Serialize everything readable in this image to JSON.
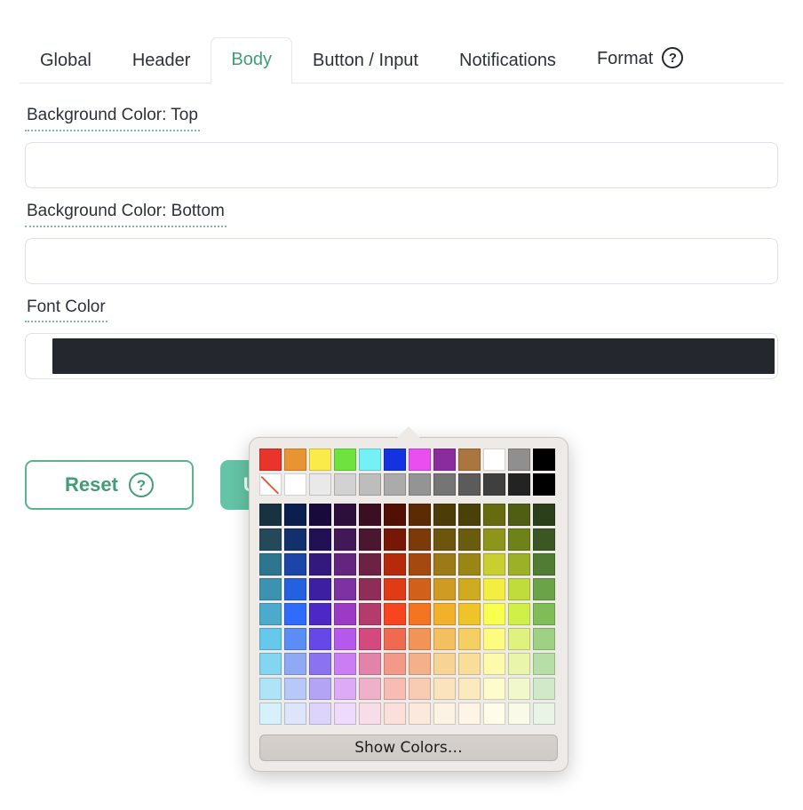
{
  "tabs": [
    {
      "label": "Global",
      "active": false,
      "help": false
    },
    {
      "label": "Header",
      "active": false,
      "help": false
    },
    {
      "label": "Body",
      "active": true,
      "help": false
    },
    {
      "label": "Button / Input",
      "active": false,
      "help": false
    },
    {
      "label": "Notifications",
      "active": false,
      "help": false
    },
    {
      "label": "Format",
      "active": false,
      "help": true
    }
  ],
  "help_icon": "?",
  "fields": [
    {
      "label": "Background Color: Top",
      "value": "",
      "filled": false
    },
    {
      "label": "Background Color: Bottom",
      "value": "",
      "filled": false
    },
    {
      "label": "Font Color",
      "value": "#24282e",
      "filled": true
    }
  ],
  "actions": {
    "reset_label": "Reset",
    "reset_help": "?",
    "update_label": "Update"
  },
  "theme": {
    "accent_green": "#3f9d77",
    "update_button_bg": "#64c4a5",
    "label_underline": "#7fba9e",
    "text_color": "#2d3239",
    "input_border": "#dde2ea",
    "popover_bg": "#eeeae7"
  },
  "color_picker": {
    "show_colors_label": "Show Colors…",
    "columns": 12,
    "standard_row": [
      "#e8342a",
      "#e99432",
      "#faea4a",
      "#6fe23f",
      "#73f1f6",
      "#1333e0",
      "#ea4ef0",
      "#8b2c9e",
      "#a9763f",
      "#ffffff",
      "#8f8f8f",
      "#000000"
    ],
    "gray_row": [
      "none",
      "#ffffff",
      "#e9e9e9",
      "#d2d2d2",
      "#bdbdbd",
      "#ababab",
      "#949494",
      "#757575",
      "#5b5b5b",
      "#3f3f3f",
      "#232323",
      "#000000"
    ],
    "grid_rows": [
      [
        "#16333f",
        "#0a1f4e",
        "#190a3c",
        "#2d0f3b",
        "#3a0f22",
        "#521004",
        "#5c2a05",
        "#4c3c07",
        "#4a4109",
        "#666b10",
        "#4f5e12",
        "#2b401a"
      ],
      [
        "#23495a",
        "#12306e",
        "#221054",
        "#431858",
        "#4b1630",
        "#771806",
        "#7c3a0b",
        "#6c560d",
        "#695c0f",
        "#8d951a",
        "#6f8219",
        "#3b5824"
      ],
      [
        "#2e7590",
        "#1d45a8",
        "#33197c",
        "#64257f",
        "#6c2243",
        "#b52a0b",
        "#a44a11",
        "#9b7a17",
        "#9a8617",
        "#c8cf2f",
        "#9cb028",
        "#517c33"
      ],
      [
        "#3d93af",
        "#2560e0",
        "#3d1fa1",
        "#7e31a1",
        "#8e2e56",
        "#e13a16",
        "#d1601a",
        "#d09b22",
        "#cfab21",
        "#f2ee42",
        "#c0db3c",
        "#6ba348"
      ],
      [
        "#4caacd",
        "#2f6bff",
        "#4d28c4",
        "#9b3bc5",
        "#b23c6c",
        "#f6451f",
        "#f47520",
        "#f2b12a",
        "#efc428",
        "#f9ff4f",
        "#d0ef48",
        "#81bd56"
      ],
      [
        "#66c8ea",
        "#5b8df6",
        "#6449e8",
        "#b758ec",
        "#d4497e",
        "#f06a52",
        "#f29357",
        "#f4bf5f",
        "#f5cf62",
        "#fdfb80",
        "#dff27e",
        "#9ed183"
      ],
      [
        "#84d5f0",
        "#8fa9f5",
        "#8b72f0",
        "#cb7df3",
        "#e283aa",
        "#f2998a",
        "#f4b08a",
        "#f7d396",
        "#f8de98",
        "#fdfaad",
        "#e8f5aa",
        "#b7dea7"
      ],
      [
        "#aee4f5",
        "#b8c8f8",
        "#b3a4f5",
        "#dcaaf7",
        "#eeb1c8",
        "#f7bcb3",
        "#f8cbb3",
        "#fae3bd",
        "#fbeabf",
        "#fefccd",
        "#f1f8cb",
        "#d1e9c8"
      ],
      [
        "#d6f1fa",
        "#dde5fb",
        "#dcd4fa",
        "#eedafc",
        "#f7dde8",
        "#fbdfdb",
        "#fce9dd",
        "#fdf3e4",
        "#fdf6e6",
        "#fffde9",
        "#f9fbe8",
        "#e9f4e6"
      ]
    ]
  }
}
